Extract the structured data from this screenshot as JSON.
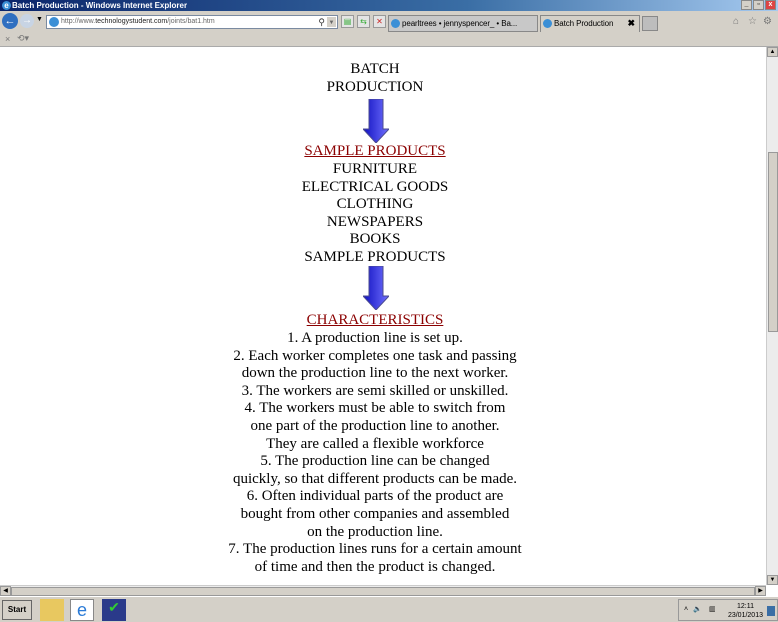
{
  "window": {
    "title": "Batch Production - Windows Internet Explorer",
    "controls": [
      "_",
      "▫",
      "x"
    ]
  },
  "nav": {
    "url_prefix": "http://www.",
    "url_domain": "technologystudent.com",
    "url_path": "/joints/bat1.htm",
    "search_icon": "magnifier-icon"
  },
  "tabs": [
    {
      "label": "pearltrees • jennyspencer_ • Ba..."
    },
    {
      "label": "Batch Production",
      "close": "✖"
    }
  ],
  "content": {
    "title_lines": [
      "BATCH",
      "PRODUCTION"
    ],
    "sample_heading": "SAMPLE PRODUCTS",
    "samples": [
      "FURNITURE",
      "ELECTRICAL GOODS",
      "CLOTHING",
      "NEWSPAPERS",
      "BOOKS",
      "SAMPLE PRODUCTS"
    ],
    "char_heading": "CHARACTERISTICS",
    "characteristics": [
      "1. A production line is set up.",
      "2. Each worker completes one task and passing",
      "down the production line to the next worker.",
      "3. The workers are semi skilled or unskilled.",
      "4. The workers must be able to switch from",
      "one part of the production line to another.",
      "They are called a flexible workforce",
      "5. The production line can be changed",
      "quickly, so that different products can be made.",
      "6. Often individual parts of the product are",
      "bought from other companies and assembled",
      "on the production line.",
      "7. The production lines runs for a certain amount",
      "of time and then the product is changed."
    ],
    "heading_color": "#8b0000",
    "arrow_color": "#2222dd"
  },
  "taskbar": {
    "start": "Start",
    "time": "12:11",
    "date": "23/01/2013"
  }
}
